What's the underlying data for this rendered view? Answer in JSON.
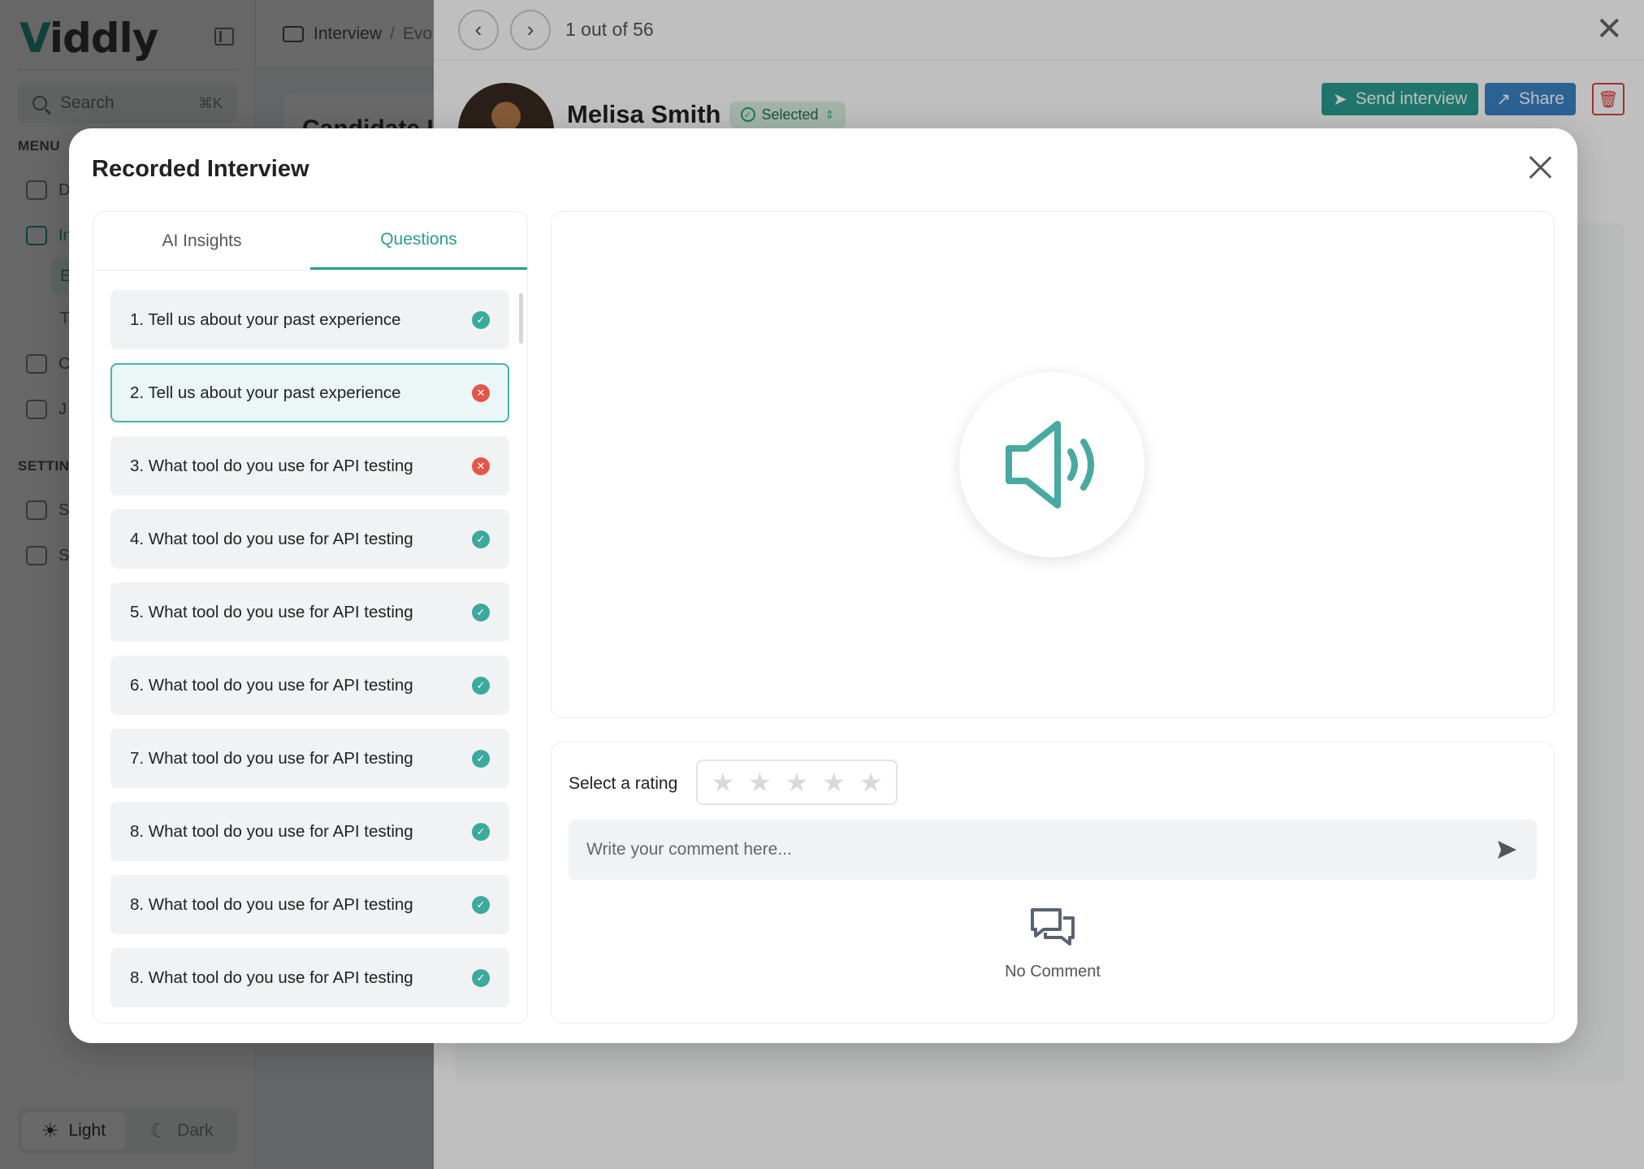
{
  "app": {
    "logo": "Viddly",
    "search": {
      "placeholder": "Search",
      "shortcut": "⌘K"
    },
    "menu_label": "MENU",
    "menu_items": [
      "D",
      "In",
      "C",
      "J"
    ],
    "interview_sub": [
      "E",
      "T"
    ],
    "settings_label": "SETTING",
    "settings_items": [
      "S",
      "S"
    ],
    "theme": {
      "light": "Light",
      "dark": "Dark",
      "selected": "Light"
    },
    "breadcrumb": {
      "first": "Interview",
      "separator": "/",
      "second": "Evo"
    },
    "candidate_card_title": "Candidate I"
  },
  "drawer": {
    "pager": "1 out of 56",
    "candidate": {
      "name": "Melisa Smith",
      "status": "Selected"
    },
    "actions": {
      "send": "Send interview",
      "share": "Share"
    }
  },
  "modal": {
    "title": "Recorded Interview",
    "tabs": [
      {
        "label": "AI Insights",
        "active": false
      },
      {
        "label": "Questions",
        "active": true
      }
    ],
    "questions": [
      {
        "text": "1. Tell us about your past experience",
        "status": "ok",
        "selected": false
      },
      {
        "text": "2. Tell us about your past experience",
        "status": "error",
        "selected": true
      },
      {
        "text": "3. What tool do you use for API testing",
        "status": "error",
        "selected": false
      },
      {
        "text": "4. What tool do you use for API testing",
        "status": "ok",
        "selected": false
      },
      {
        "text": "5. What tool do you use for API testing",
        "status": "ok",
        "selected": false
      },
      {
        "text": "6. What tool do you use for API testing",
        "status": "ok",
        "selected": false
      },
      {
        "text": "7. What tool do you use for API testing",
        "status": "ok",
        "selected": false
      },
      {
        "text": "8. What tool do you use for API testing",
        "status": "ok",
        "selected": false
      },
      {
        "text": "8. What tool do you use for API testing",
        "status": "ok",
        "selected": false
      },
      {
        "text": "8. What tool do you use for API testing",
        "status": "ok",
        "selected": false
      }
    ],
    "player": {
      "icon": "speaker-icon"
    },
    "rating": {
      "label": "Select a rating",
      "value": 0,
      "max": 5
    },
    "comment": {
      "placeholder": "Write your comment here...",
      "value": ""
    },
    "empty_comments": "No Comment"
  },
  "colors": {
    "accent": "#2a9d8f",
    "share": "#3b82c4",
    "danger": "#d9423a",
    "error": "#e4554a",
    "success": "#3ba99c"
  }
}
